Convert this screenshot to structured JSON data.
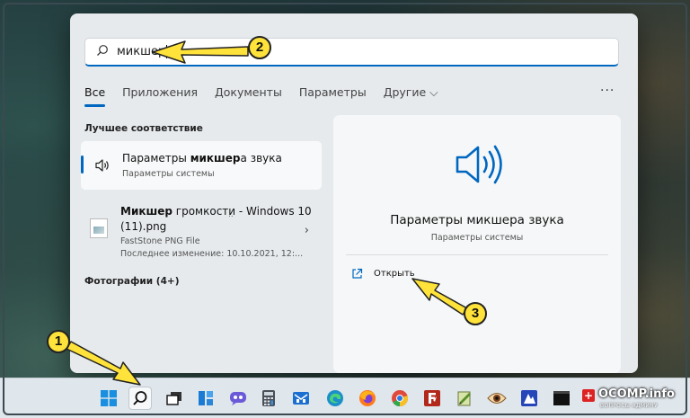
{
  "search": {
    "icon": "search-icon",
    "value": "микшер"
  },
  "tabs": [
    {
      "label": "Все",
      "active": true
    },
    {
      "label": "Приложения"
    },
    {
      "label": "Документы"
    },
    {
      "label": "Параметры"
    },
    {
      "label": "Другие ⌵"
    }
  ],
  "more_label": "···",
  "best_match": {
    "section_title": "Лучшее соответствие",
    "icon": "speaker-icon",
    "title_prefix": "Параметры ",
    "title_bold": "микшер",
    "title_suffix": "а звука",
    "subtitle": "Параметры системы"
  },
  "file_result": {
    "icon": "png-file-icon",
    "title_bold": "Микшер",
    "title_suffix": " громкости - Windows 10",
    "title_line2": "(11).png",
    "type": "FastStone PNG File",
    "modified": "Последнее изменение: 10.10.2021, 12:..."
  },
  "photos_section": "Фотографии (4+)",
  "small_mark": "..",
  "detail": {
    "icon": "speaker-icon",
    "title": "Параметры микшера звука",
    "subtitle": "Параметры системы",
    "open_label": "Открыть",
    "open_icon": "open-external-icon"
  },
  "taskbar_icons": [
    "windows-start-icon",
    "search-icon",
    "task-view-icon",
    "widgets-icon",
    "chat-icon",
    "calculator-icon",
    "mail-icon",
    "edge-icon",
    "firefox-icon",
    "chrome-icon",
    "filezilla-icon",
    "notepad-icon",
    "eye-app-icon",
    "image-app-icon",
    "terminal-icon"
  ],
  "brand": {
    "name": "OCOMP.info",
    "tagline": "ВОПРОСЫ АДМИНУ"
  },
  "annotations": {
    "badge_1": "1",
    "badge_2": "2",
    "badge_3": "3"
  },
  "colors": {
    "accent": "#0067c0",
    "arrow_fill": "#ffe23a"
  }
}
